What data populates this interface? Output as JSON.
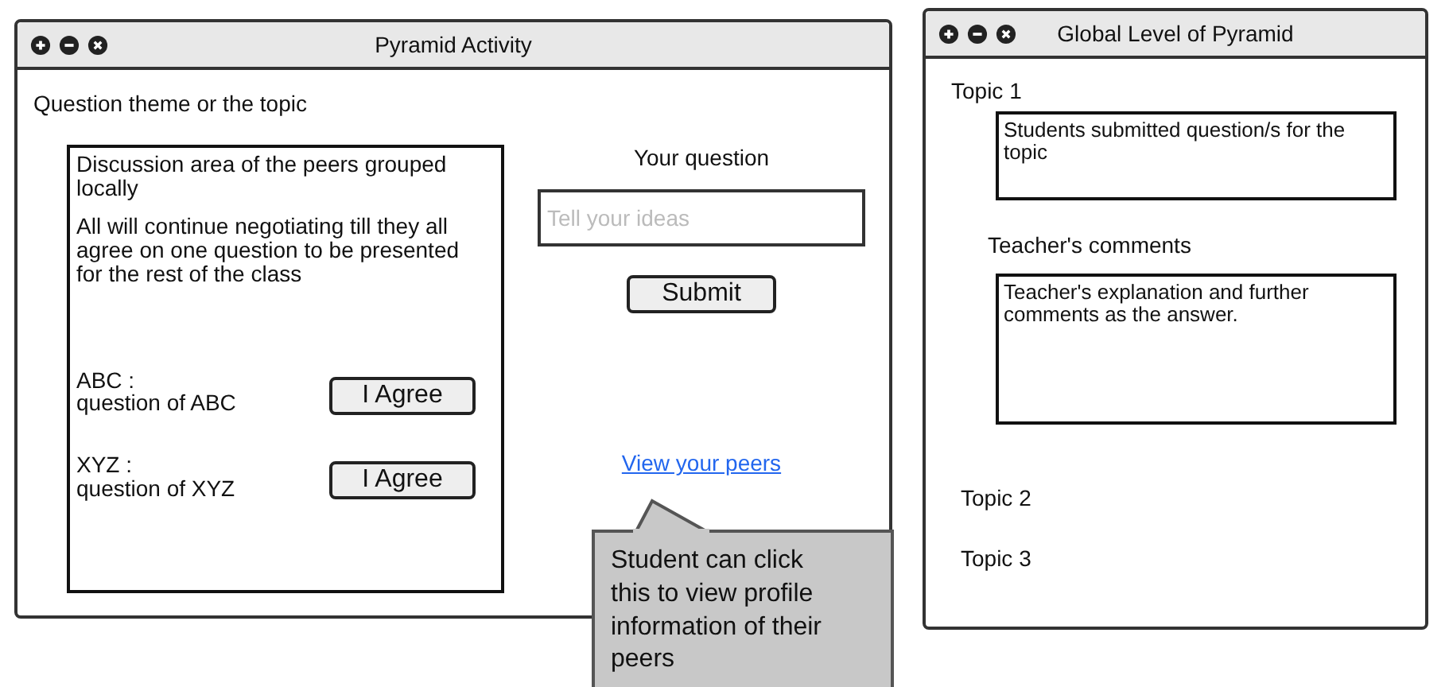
{
  "activity_window": {
    "title": "Pyramid Activity",
    "topic_label": "Question theme or the topic",
    "discussion": {
      "paragraphs": [
        "Discussion area of the peers grouped locally",
        "All will continue negotiating till they all agree on one question to be presented for the rest of the class"
      ],
      "entries": [
        {
          "name": "ABC :",
          "question": "question of ABC",
          "button": "I Agree"
        },
        {
          "name": "XYZ :",
          "question": "question of XYZ",
          "button": "I Agree"
        }
      ]
    },
    "question_label": "Your question",
    "question_placeholder": "Tell your ideas",
    "submit": "Submit",
    "peers_link": "View your peers"
  },
  "callout": "Student can click this to view profile information of their peers",
  "global_window": {
    "title": "Global Level of Pyramid",
    "topics": [
      {
        "label": "Topic 1",
        "questions": "Students submitted question/s for the topic",
        "comments_label": "Teacher's comments",
        "comments": "Teacher's explanation and further comments as the answer."
      },
      {
        "label": "Topic 2"
      },
      {
        "label": "Topic 3"
      }
    ]
  }
}
